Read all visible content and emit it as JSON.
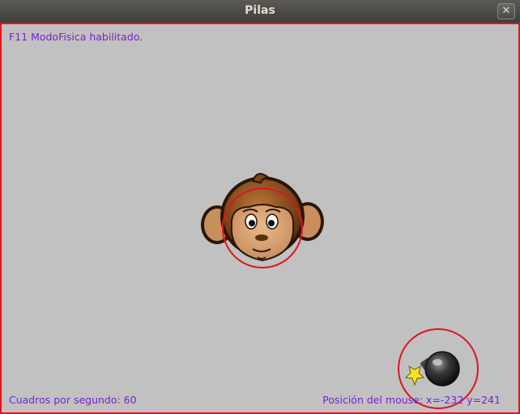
{
  "window": {
    "title": "Pilas",
    "close_label": "✕"
  },
  "hud": {
    "status_message": "F11 ModoFisica habilitado.",
    "fps_text": "Cuadros por segundo: 60",
    "mouse_text": "Posición del mouse: x=-232 y=241"
  },
  "scene": {
    "actors": [
      {
        "kind": "monkey",
        "icon": "monkey-face-icon"
      },
      {
        "kind": "bomb",
        "icon": "bomb-icon"
      }
    ],
    "collision_shape": "circle"
  },
  "colors": {
    "canvas_background": "#c1c1c1",
    "collision_outline": "#e0141e",
    "hud_text": "#7a1fd1"
  }
}
